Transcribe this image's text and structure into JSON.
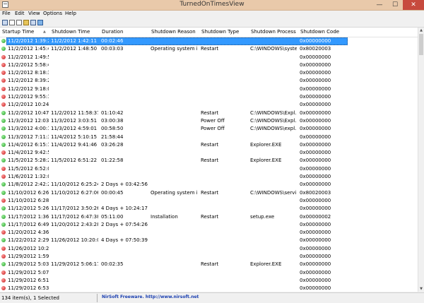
{
  "window": {
    "title": "TurnedOnTimesView",
    "minimize_glyph": "—",
    "maximize_glyph": "☐",
    "close_glyph": "✕"
  },
  "menu": [
    "File",
    "Edit",
    "View",
    "Options",
    "Help"
  ],
  "toolbar": {
    "icons": [
      "save-icon",
      "properties-icon",
      "copy-icon",
      "open-folder-icon",
      "refresh-icon",
      "export-icon"
    ]
  },
  "columns": [
    "Startup Time",
    "Shutdown Time",
    "Duration",
    "Shutdown Reason",
    "Shutdown Type",
    "Shutdown Process",
    "Shutdown Code"
  ],
  "sort_arrow": "▲",
  "rows": [
    {
      "status": "green",
      "cells": [
        "11/2/2012 1:39:2...",
        "11/2/2012 1:42:11 ...",
        "00:02:46",
        "",
        "",
        "",
        "0x00000000"
      ],
      "selected": true
    },
    {
      "status": "green",
      "cells": [
        "11/2/2012 1:45:4...",
        "11/2/2012 1:48:50 ...",
        "00:03:03",
        "Operating system i...",
        "Restart",
        "C:\\WINDOWS\\syste...",
        "0x80020003"
      ]
    },
    {
      "status": "red",
      "cells": [
        "11/2/2012 1:49:5...",
        "",
        "",
        "",
        "",
        "",
        "0x00000000"
      ]
    },
    {
      "status": "red",
      "cells": [
        "11/2/2012 5:58:4...",
        "",
        "",
        "",
        "",
        "",
        "0x00000000"
      ]
    },
    {
      "status": "red",
      "cells": [
        "11/2/2012 8:18:3...",
        "",
        "",
        "",
        "",
        "",
        "0x00000000"
      ]
    },
    {
      "status": "red",
      "cells": [
        "11/2/2012 8:39:2...",
        "",
        "",
        "",
        "",
        "",
        "0x00000000"
      ]
    },
    {
      "status": "red",
      "cells": [
        "11/2/2012 9:18:0...",
        "",
        "",
        "",
        "",
        "",
        "0x00000000"
      ]
    },
    {
      "status": "red",
      "cells": [
        "11/2/2012 9:55:1...",
        "",
        "",
        "",
        "",
        "",
        "0x00000000"
      ]
    },
    {
      "status": "red",
      "cells": [
        "11/2/2012 10:24:...",
        "",
        "",
        "",
        "",
        "",
        "0x00000000"
      ]
    },
    {
      "status": "green",
      "cells": [
        "11/2/2012 10:47:...",
        "11/2/2012 11:58:37...",
        "01:10:42",
        "",
        "Restart",
        "C:\\WINDOWS\\Expl...",
        "0x00000000"
      ]
    },
    {
      "status": "green",
      "cells": [
        "11/3/2012 12:03:...",
        "11/3/2012 3:03:51 ...",
        "03:00:38",
        "",
        "Power Off",
        "C:\\WINDOWS\\Expl...",
        "0x00000000"
      ]
    },
    {
      "status": "green",
      "cells": [
        "11/3/2012 4:00:1...",
        "11/3/2012 4:59:01 ...",
        "00:58:50",
        "",
        "Power Off",
        "C:\\WINDOWS\\expl...",
        "0x00000000"
      ]
    },
    {
      "status": "green",
      "cells": [
        "11/3/2012 7:11:3...",
        "11/4/2012 5:10:15 ...",
        "21:58:44",
        "",
        "",
        "",
        "0x00000000"
      ]
    },
    {
      "status": "green",
      "cells": [
        "11/4/2012 6:15:1...",
        "11/4/2012 9:41:46 ...",
        "03:26:28",
        "",
        "Restart",
        "Explorer.EXE",
        "0x00000000"
      ]
    },
    {
      "status": "red",
      "cells": [
        "11/4/2012 9:42:5...",
        "",
        "",
        "",
        "",
        "",
        "0x00000000"
      ]
    },
    {
      "status": "green",
      "cells": [
        "11/5/2012 5:28:2...",
        "11/5/2012 6:51:22 ...",
        "01:22:58",
        "",
        "Restart",
        "Explorer.EXE",
        "0x00000000"
      ]
    },
    {
      "status": "red",
      "cells": [
        "11/5/2012 6:52:0...",
        "",
        "",
        "",
        "",
        "",
        "0x00000000"
      ]
    },
    {
      "status": "red",
      "cells": [
        "11/6/2012 1:32:0...",
        "",
        "",
        "",
        "",
        "",
        "0x00000000"
      ]
    },
    {
      "status": "green",
      "cells": [
        "11/8/2012 2:42:2...",
        "11/10/2012 6:25:24...",
        "2 Days + 03:42:56",
        "",
        "",
        "",
        "0x00000000"
      ]
    },
    {
      "status": "green",
      "cells": [
        "11/10/2012 6:26:...",
        "11/10/2012 6:27:06...",
        "00:00:45",
        "Operating system i...",
        "Restart",
        "C:\\WINDOWS\\servi...",
        "0x80020003"
      ]
    },
    {
      "status": "red",
      "cells": [
        "11/10/2012 6:28:...",
        "",
        "",
        "",
        "",
        "",
        "0x00000000"
      ]
    },
    {
      "status": "green",
      "cells": [
        "11/12/2012 5:26:...",
        "11/17/2012 3:50:26...",
        "4 Days + 10:24:17",
        "",
        "",
        "",
        "0x00000000"
      ]
    },
    {
      "status": "green",
      "cells": [
        "11/17/2012 1:36:...",
        "11/17/2012 6:47:38...",
        "05:11:00",
        "Installation",
        "Restart",
        "setup.exe",
        "0x00000002"
      ]
    },
    {
      "status": "green",
      "cells": [
        "11/17/2012 6:49:...",
        "11/20/2012 2:43:28...",
        "2 Days + 07:54:26",
        "",
        "",
        "",
        "0x00000000"
      ]
    },
    {
      "status": "red",
      "cells": [
        "11/20/2012 4:36:...",
        "",
        "",
        "",
        "",
        "",
        "0x00000000"
      ]
    },
    {
      "status": "green",
      "cells": [
        "11/22/2012 2:29:...",
        "11/26/2012 10:20:0...",
        "4 Days + 07:50:39",
        "",
        "",
        "",
        "0x00000000"
      ]
    },
    {
      "status": "red",
      "cells": [
        "11/26/2012 10:21...",
        "",
        "",
        "",
        "",
        "",
        "0x00000000"
      ]
    },
    {
      "status": "red",
      "cells": [
        "11/29/2012 1:59:...",
        "",
        "",
        "",
        "",
        "",
        "0x00000000"
      ]
    },
    {
      "status": "green",
      "cells": [
        "11/29/2012 5:03:...",
        "11/29/2012 5:06:17...",
        "00:02:35",
        "",
        "Restart",
        "Explorer.EXE",
        "0x00000000"
      ]
    },
    {
      "status": "red",
      "cells": [
        "11/29/2012 5:07:...",
        "",
        "",
        "",
        "",
        "",
        "0x00000000"
      ]
    },
    {
      "status": "red",
      "cells": [
        "11/29/2012 6:51:...",
        "",
        "",
        "",
        "",
        "",
        "0x00000000"
      ]
    },
    {
      "status": "red",
      "cells": [
        "11/29/2012 6:53:...",
        "",
        "",
        "",
        "",
        "",
        "0x00000000"
      ]
    }
  ],
  "status": {
    "count": "134 item(s), 1 Selected",
    "credit": "NirSoft Freeware.  http://www.nirsoft.net"
  },
  "colors": {
    "selection": "#3399ff",
    "titlebar": "#e9c9aa",
    "close_button": "#c74a3e",
    "status_ok": "#1e9a1e",
    "status_bad": "#c21414",
    "credit_link": "#1a3fb0"
  }
}
